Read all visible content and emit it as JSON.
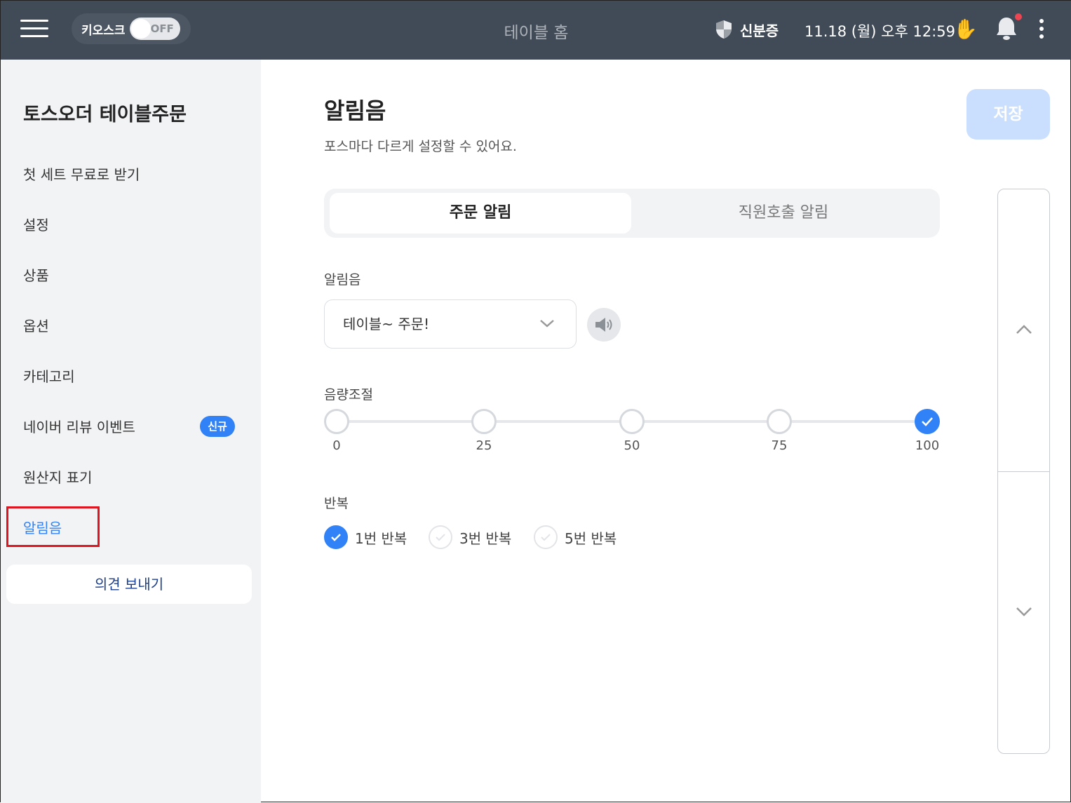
{
  "header": {
    "kiosk_label": "키오스크",
    "kiosk_toggle": "OFF",
    "title": "테이블 홈",
    "id_label": "신분증",
    "datetime": "11.18 (월) 오후 12:59"
  },
  "sidebar": {
    "brand": "토스오더 테이블주문",
    "items": [
      {
        "label": "첫 세트 무료로 받기"
      },
      {
        "label": "설정"
      },
      {
        "label": "상품"
      },
      {
        "label": "옵션"
      },
      {
        "label": "카테고리"
      },
      {
        "label": "네이버 리뷰 이벤트",
        "badge": "신규"
      },
      {
        "label": "원산지 표기"
      },
      {
        "label": "알림음"
      }
    ],
    "feedback": "의견 보내기"
  },
  "main": {
    "title": "알림음",
    "subtitle": "포스마다 다르게 설정할 수 있어요.",
    "save": "저장",
    "tabs": [
      {
        "label": "주문 알림"
      },
      {
        "label": "직원호출 알림"
      }
    ],
    "sound_label": "알림음",
    "sound_value": "테이블~ 주문!",
    "volume_label": "음량조절",
    "volume_stops": [
      "0",
      "25",
      "50",
      "75",
      "100"
    ],
    "volume_selected": 100,
    "repeat_label": "반복",
    "repeat_options": [
      "1번 반복",
      "3번 반복",
      "5번 반복"
    ],
    "repeat_selected": "1번 반복"
  },
  "colors": {
    "accent": "#3182f6",
    "header": "#414b57"
  }
}
